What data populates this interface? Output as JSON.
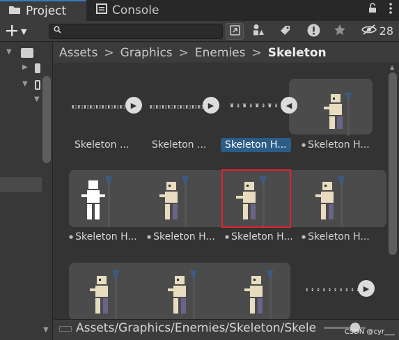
{
  "tabs": [
    {
      "label": "Project",
      "icon": "folder-icon",
      "active": true
    },
    {
      "label": "Console",
      "icon": "console-icon",
      "active": false
    }
  ],
  "toolbar": {
    "search_placeholder": "",
    "hidden_count": "28"
  },
  "breadcrumb": [
    "Assets",
    "Graphics",
    "Enemies",
    "Skeleton"
  ],
  "assets": {
    "row1": [
      "Skeleton ...",
      "Skeleton ...",
      "Skeleton H...",
      "Skeleton H..."
    ],
    "row2": [
      "Skeleton H...",
      "Skeleton H...",
      "Skeleton H...",
      "Skeleton H..."
    ]
  },
  "bottom": {
    "path": "Assets/Graphics/Enemies/Skeleton/Skele",
    "watermark": "CSDN @cyr___"
  },
  "colors": {
    "accent": "#3a79bb",
    "selected_label": "#2c5d87",
    "highlight_box": "#e0232e"
  }
}
